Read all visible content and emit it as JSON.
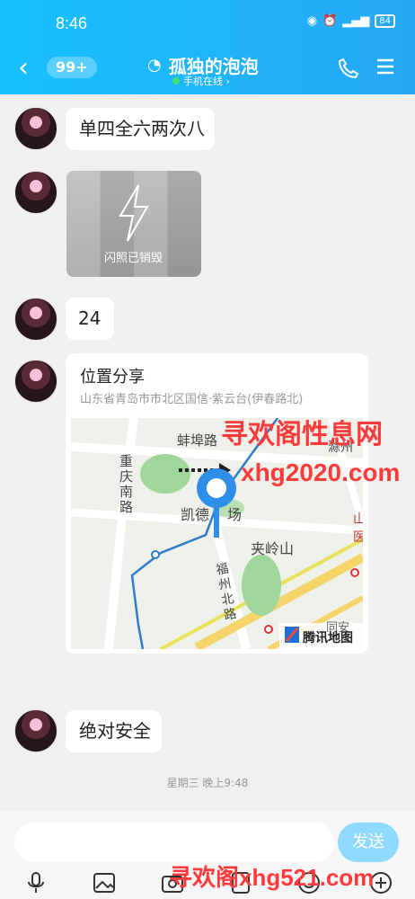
{
  "status": {
    "time": "8:46",
    "battery": "84"
  },
  "header": {
    "back_badge": "99+",
    "title": "孤独的泡泡",
    "online": "手机在线 ›"
  },
  "messages": [
    {
      "type": "text",
      "text": "单四全六两次八"
    },
    {
      "type": "flash_image",
      "label": "闪照已销毁"
    },
    {
      "type": "text",
      "text": "24"
    },
    {
      "type": "location",
      "title": "位置分享",
      "address": "山东省青岛市市北区国信·紫云台(伊春路北)",
      "map_labels": [
        "重庆南路",
        "蚌埠路",
        "凯德",
        "场",
        "夹岭山",
        "福州北路",
        "滁州",
        "山",
        "医",
        "同安",
        "腾讯地图"
      ]
    },
    {
      "type": "text",
      "text": "绝对安全"
    }
  ],
  "date_separator": "星期三 晚上9:48",
  "input": {
    "placeholder": "",
    "send": "发送"
  },
  "watermarks": [
    "寻欢阁性息网",
    "xhg2020.com",
    "寻欢阁xhg521.com"
  ],
  "colors": {
    "accent": "#18c1ff",
    "send": "#8fd8ff",
    "watermark": "#ff3a3a"
  }
}
